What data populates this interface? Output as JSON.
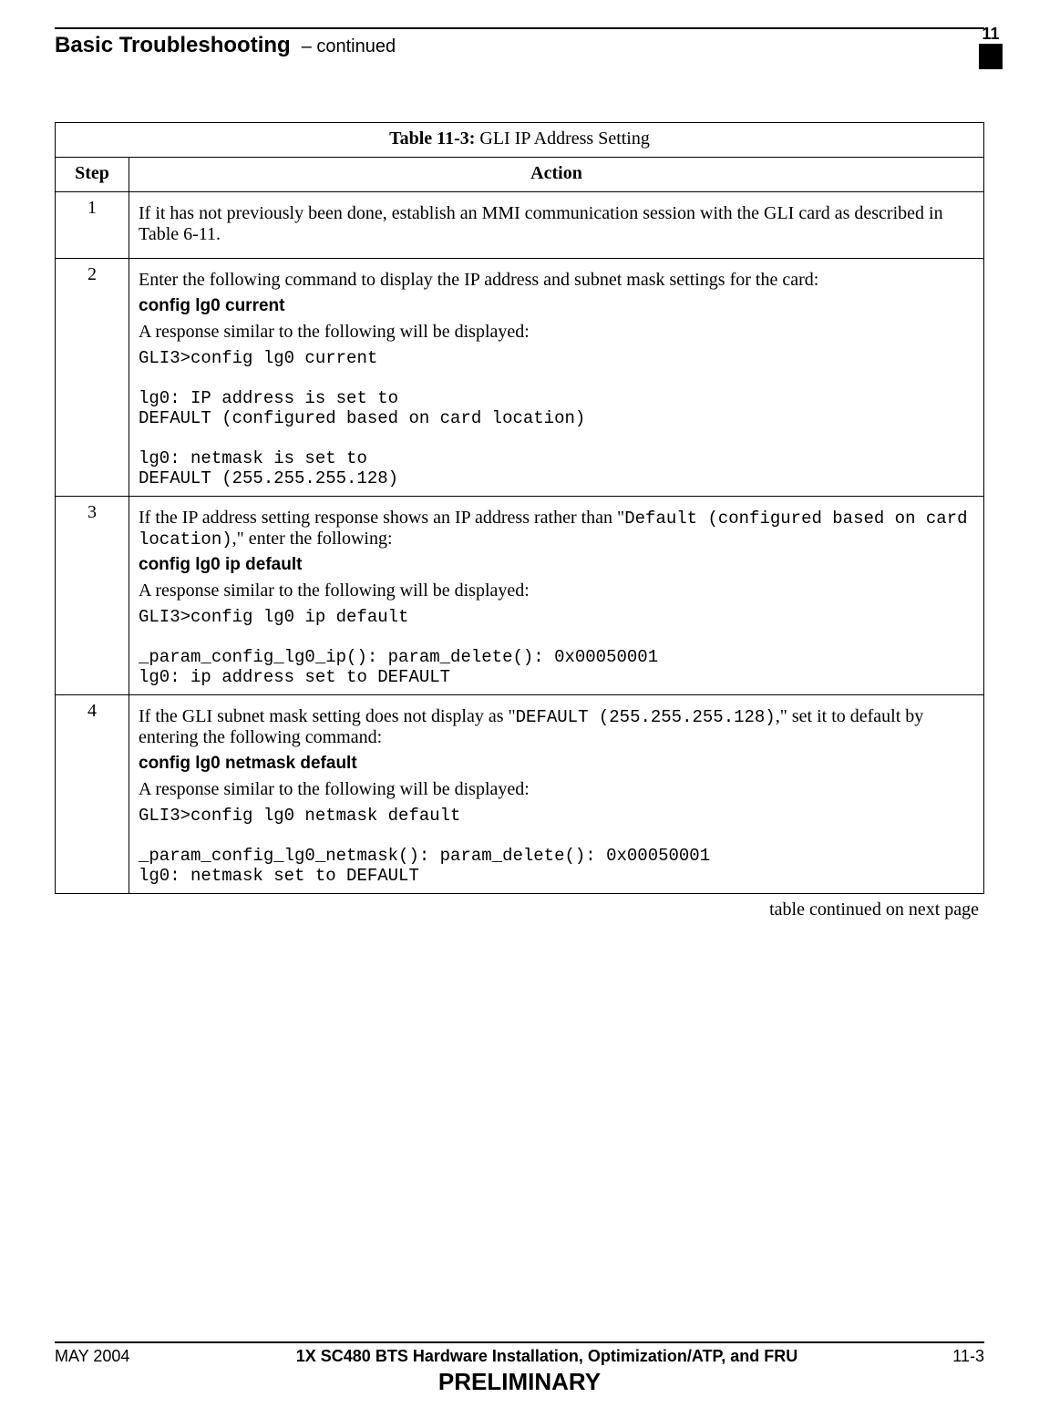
{
  "header": {
    "title": "Basic Troubleshooting",
    "continued": "– continued",
    "chapter": "11"
  },
  "table": {
    "caption_label": "Table 11-3:",
    "caption_text": " GLI IP Address Setting",
    "col_step": "Step",
    "col_action": "Action",
    "rows": [
      {
        "num": "1",
        "p1": "If it has not previously been done, establish an MMI communication session with the GLI card as described in Table 6-11."
      },
      {
        "num": "2",
        "p1": "Enter the following command to display the IP address and subnet mask settings for the card:",
        "cmd": "config lg0 current",
        "p2": "A response similar to the following will be displayed:",
        "out": "GLI3>config lg0 current\n\nlg0: IP address is set to\nDEFAULT (configured based on card location)\n\nlg0: netmask is set to\nDEFAULT (255.255.255.128)"
      },
      {
        "num": "3",
        "p1a": "If the IP address setting response shows an IP address rather than \"",
        "p1_code": "Default (configured based on card location)",
        "p1b": ",\" enter the following:",
        "cmd": "config lg0 ip default",
        "p2": "A response similar to the following will be displayed:",
        "out": "GLI3>config lg0 ip default\n\n_param_config_lg0_ip(): param_delete(): 0x00050001\nlg0: ip address set to DEFAULT"
      },
      {
        "num": "4",
        "p1a": "If the GLI subnet mask setting does not display as \"",
        "p1_code": "DEFAULT (255.255.255.128)",
        "p1b": ",\" set it to default by entering the following command:",
        "cmd": "config lg0 netmask default",
        "p2": "A response similar to the following will be displayed:",
        "out": "GLI3>config lg0 netmask default\n\n_param_config_lg0_netmask(): param_delete(): 0x00050001\nlg0: netmask set to DEFAULT"
      }
    ],
    "continuation": "table continued on next page"
  },
  "footer": {
    "left": "MAY 2004",
    "center": "1X SC480 BTS Hardware Installation, Optimization/ATP, and FRU",
    "right": "11-3",
    "preliminary": "PRELIMINARY"
  }
}
